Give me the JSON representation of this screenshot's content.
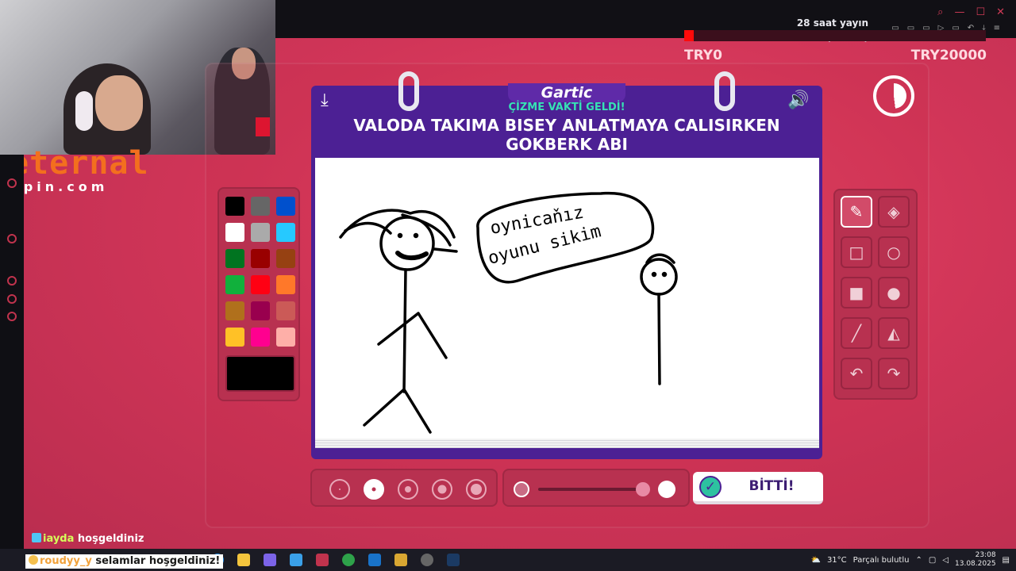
{
  "stream": {
    "duration": "28 saat yayın",
    "donation_progress": "619₺ (3.09%)",
    "donation_fraction": 0.0309,
    "min_label": "TRY0",
    "max_label": "TRY20000",
    "brand": {
      "main": "eternal",
      "sub": "epin.com"
    }
  },
  "game": {
    "logo": "Gartic",
    "subtitle": "ÇİZME VAKTİ GELDİ!",
    "prompt_line1": "VALODA TAKIMA BISEY ANLATMAYA CALISIRKEN",
    "prompt_line2": "GOKBERK ABI",
    "done_label": "BİTTİ!",
    "timer_fraction": 0.48,
    "speech_text_line1": "oynicaňız",
    "speech_text_line2": "oyunu sikim",
    "palette": [
      "#000000",
      "#666666",
      "#0050cd",
      "#ffffff",
      "#aaaaaa",
      "#26c9ff",
      "#017420",
      "#990000",
      "#964112",
      "#11b03c",
      "#ff0013",
      "#ff7829",
      "#b0701c",
      "#99004e",
      "#cb5a57",
      "#ffc126",
      "#ff008f",
      "#feafa8"
    ],
    "current_color": "#000000",
    "tools": [
      "pencil-icon",
      "eraser-icon",
      "rect-outline-icon",
      "circle-outline-icon",
      "rect-fill-icon",
      "circle-fill-icon",
      "line-icon",
      "fill-bucket-icon",
      "undo-icon",
      "redo-icon"
    ],
    "brush_sizes": [
      "xs",
      "s",
      "m",
      "l",
      "xl"
    ],
    "brush_size_selected": 1
  },
  "chat": {
    "line1_user": "iayda",
    "line1_text": "hoşgeldiniz",
    "line2_user": "roudyy_y",
    "line2_text": "selamlar hoşgeldiniz!"
  },
  "taskbar": {
    "weather": "31°C",
    "weather_desc": "Parçalı bulutlu",
    "time": "23:08",
    "date": "13.08.2025"
  }
}
